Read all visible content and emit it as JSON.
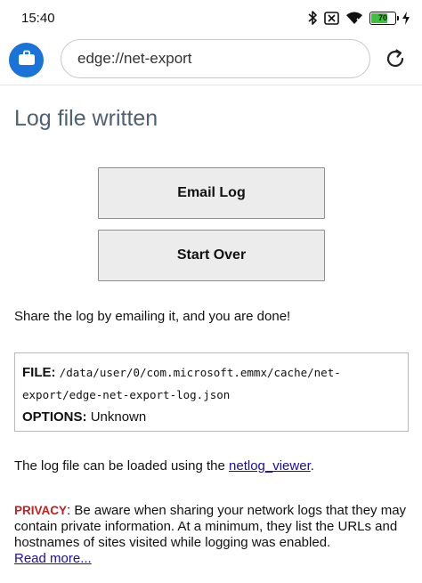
{
  "status": {
    "time": "15:40",
    "battery_level": "70",
    "battery_fraction": 0.7
  },
  "toolbar": {
    "address_value": "edge://net-export",
    "profile_icon": "briefcase-icon",
    "reload_icon": "reload-icon",
    "accent_color": "#1a73d9"
  },
  "page": {
    "title": "Log file written",
    "email_button": "Email Log",
    "start_over_button": "Start Over",
    "share_text": "Share the log by emailing it, and you are done!",
    "file": {
      "file_label": "FILE:",
      "file_path_line1": "/data/user/0/com.microsoft.emmx/cache/net-",
      "file_path_line2": "export/edge-net-export-log.json",
      "options_label": "OPTIONS:",
      "options_value": "Unknown"
    },
    "loader_prefix": "The log file can be loaded using the ",
    "loader_link": "netlog_viewer",
    "loader_suffix": ".",
    "privacy_label": "PRIVACY",
    "privacy_text": ": Be aware when sharing your network logs that they may contain private information. At a minimum, they list the URLs and hostnames of sites visited while logging was enabled.",
    "read_more": "Read more..."
  }
}
